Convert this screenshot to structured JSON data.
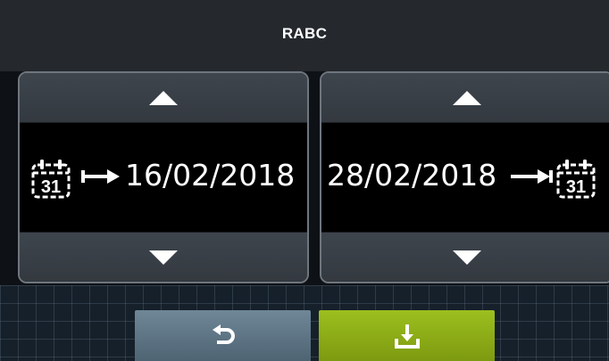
{
  "header": {
    "title": "RABC"
  },
  "start": {
    "date": "16/02/2018",
    "calendar_day": "31",
    "icon": "calendar-start-icon"
  },
  "end": {
    "date": "28/02/2018",
    "calendar_day": "31",
    "icon": "calendar-end-icon"
  },
  "toolbar": {
    "back_icon": "undo-arrow-icon",
    "save_icon": "download-save-icon"
  },
  "colors": {
    "background": "#16202a",
    "panel_border": "#6e767e",
    "arrow_button": "#3b4249",
    "back_button": "#5f7685",
    "save_button": "#8fb019",
    "text": "#ffffff"
  }
}
